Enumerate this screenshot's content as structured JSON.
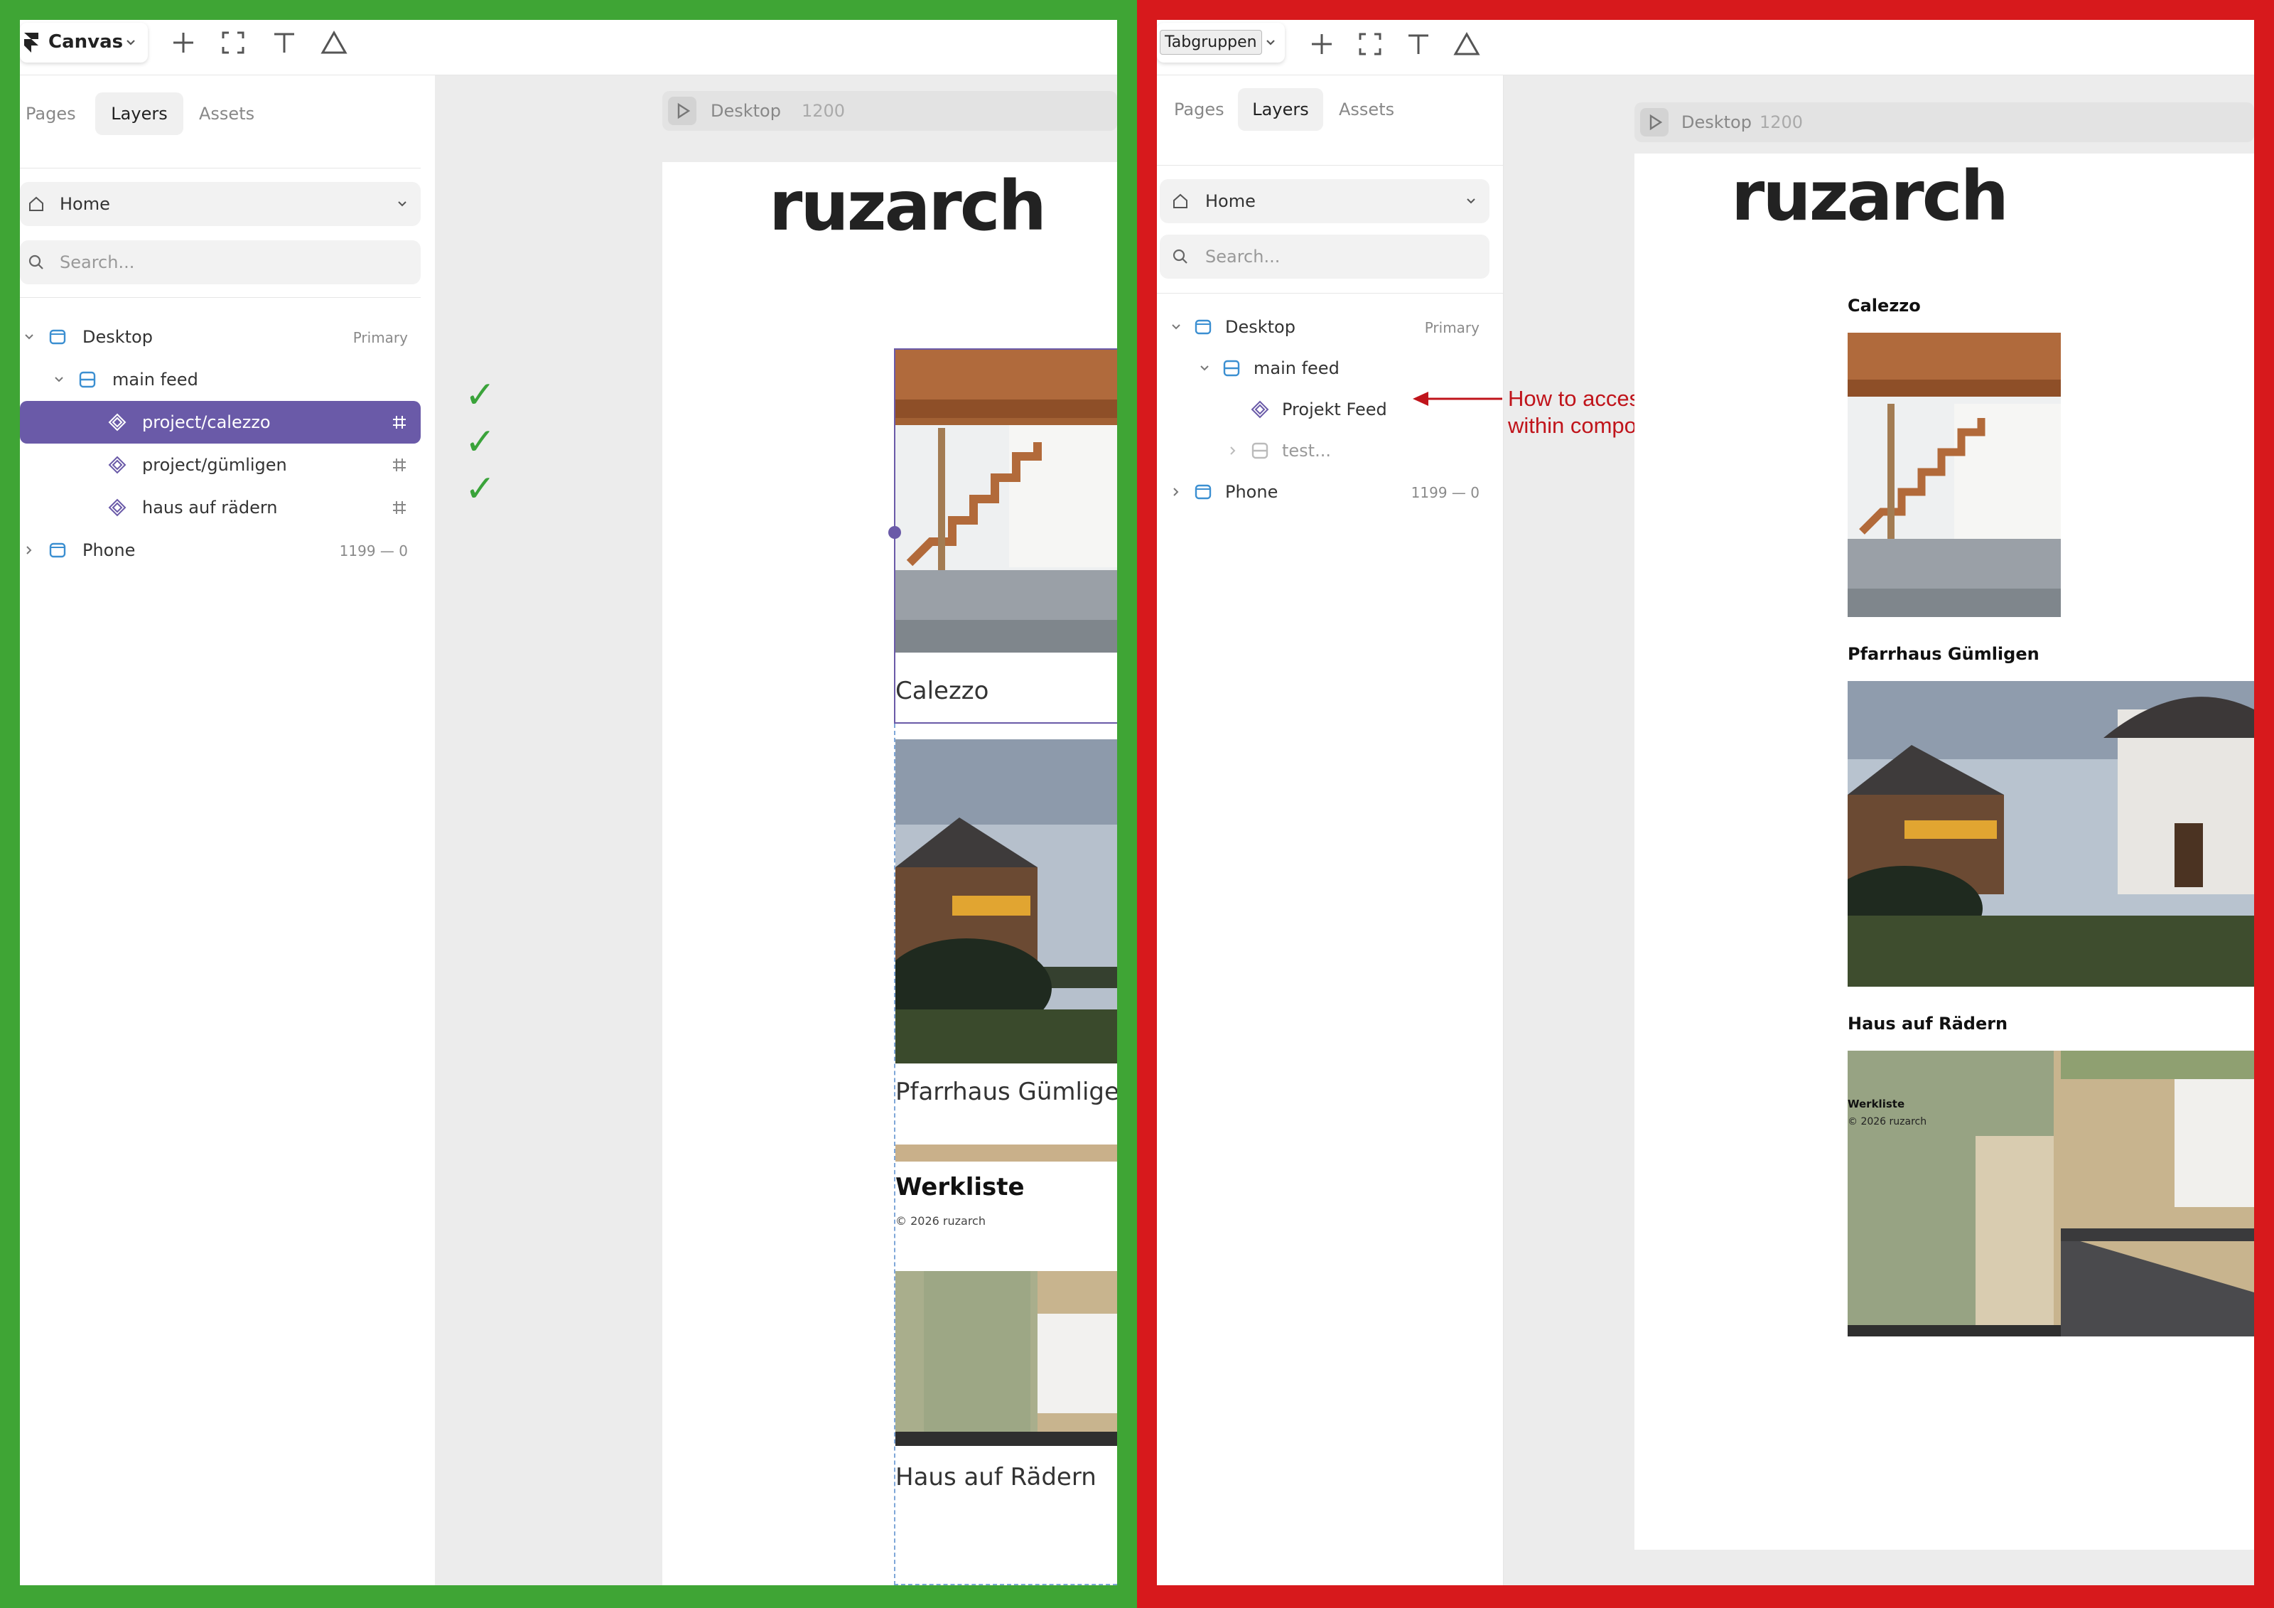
{
  "left": {
    "border_color": "#3fa535",
    "toolbar": {
      "project_name": "Canvas"
    },
    "tabs": [
      "Pages",
      "Layers",
      "Assets"
    ],
    "page_selector": "Home",
    "search_placeholder": "Search...",
    "layers": [
      {
        "label": "Desktop",
        "meta": "Primary",
        "icon": "frame-icon"
      },
      {
        "label": "main feed",
        "icon": "stack-icon"
      },
      {
        "label": "project/calezzo",
        "icon": "component-icon",
        "selected": true
      },
      {
        "label": "project/gümligen",
        "icon": "component-icon"
      },
      {
        "label": "haus auf rädern",
        "icon": "component-icon"
      },
      {
        "label": "Phone",
        "meta": "1199 — 0",
        "icon": "frame-icon"
      }
    ],
    "checkmarks": [
      "✓",
      "✓",
      "✓"
    ],
    "canvas": {
      "frame_name": "Desktop",
      "frame_width": "1200",
      "logo": "ruzarch",
      "feed": [
        "Calezzo",
        "Pfarrhaus Gümlige",
        "Werkliste",
        "© 2026 ruzarch",
        "Haus auf Rädern"
      ]
    },
    "accent": "#6a5aa8"
  },
  "right": {
    "border_color": "#d7191c",
    "toolbar": {
      "project_name": "Tabgruppen"
    },
    "tabs": [
      "Pages",
      "Layers",
      "Assets"
    ],
    "page_selector": "Home",
    "search_placeholder": "Search...",
    "layers": [
      {
        "label": "Desktop",
        "meta": "Primary",
        "icon": "frame-icon"
      },
      {
        "label": "main feed",
        "icon": "stack-icon"
      },
      {
        "label": "Projekt Feed",
        "icon": "component-icon"
      },
      {
        "label": "test...",
        "icon": "stack-icon",
        "dimmed": true
      },
      {
        "label": "Phone",
        "meta": "1199 — 0",
        "icon": "frame-icon"
      }
    ],
    "annotation": "How to access scroll section\nwithin component ?",
    "canvas": {
      "frame_name": "Desktop",
      "frame_width": "1200",
      "logo": "ruzarch",
      "feed": [
        "Calezzo",
        "Pfarrhaus Gümligen",
        "Haus auf Rädern",
        "Werkliste",
        "© 2026 ruzarch"
      ]
    }
  }
}
